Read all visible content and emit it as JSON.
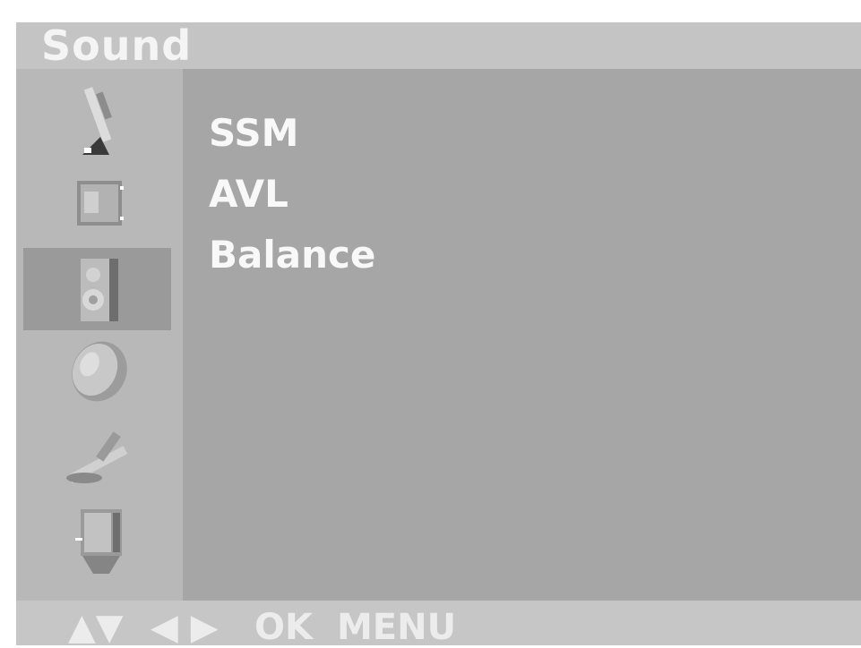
{
  "window": {
    "title": "Sound"
  },
  "sidebar": {
    "items": [
      {
        "icon": "satellite-antenna-icon",
        "selected": false
      },
      {
        "icon": "picture-screen-icon",
        "selected": false
      },
      {
        "icon": "speaker-icon",
        "selected": true
      },
      {
        "icon": "clock-icon",
        "selected": false
      },
      {
        "icon": "wrench-tool-icon",
        "selected": false
      },
      {
        "icon": "tv-input-icon",
        "selected": false
      }
    ]
  },
  "menu": {
    "items": [
      {
        "label": "SSM"
      },
      {
        "label": "AVL"
      },
      {
        "label": "Balance"
      }
    ]
  },
  "footer": {
    "updown": "▲▼",
    "leftright": "◀ ▶",
    "ok": "OK",
    "menu": "MENU"
  },
  "colors": {
    "panel": "#a6a6a6",
    "sidebar": "#b8b8b8",
    "selected": "#9a9a9a",
    "text": "#f8f8f8"
  }
}
